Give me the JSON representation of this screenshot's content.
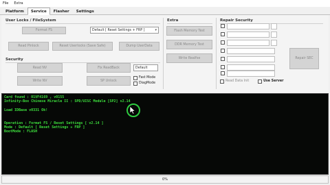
{
  "menu": [
    "File",
    "Extra"
  ],
  "tabs": [
    "Platform",
    "Service",
    "Flasher",
    "Settings"
  ],
  "active_tab": "Service",
  "sections": {
    "user_locks": "User Locks / FileSystem",
    "security": "Security",
    "extra": "Extra",
    "repair_security": "Repair Security"
  },
  "buttons": {
    "format_fs": "Format FS",
    "read_pinlock": "Read Pinlock",
    "reset_userlocks": "Reset Userlocks (Save Safe)",
    "dump_userdata": "Dump UserData",
    "read_nv": "Read NV",
    "fix_readback": "Fix ReadBack",
    "write_nv": "Write NV",
    "sp_unlock": "SP Unlock",
    "flash_memory_test": "Flash Memory Test",
    "ddr_memory_test": "DDR Memory Test",
    "write_readfse": "Write Realfse",
    "repair_sec": "Repair SEC"
  },
  "format_select": "Default [ Reset Settings + FRP ]",
  "security_select": "Default",
  "checkboxes": {
    "fast_mode": "Fast Mode",
    "diag_mode": "DiagMode",
    "read_data_init": "Read Data Init",
    "use_server": "Use Server"
  },
  "colors": {
    "log_bg": "#060806",
    "log_text": "#3de03d",
    "cursor_ring": "#2ecc40"
  },
  "log": [
    "Card found : 01VF4169 , v0155",
    "Infinity-Box Chinese Miracle II : SPD/UISC Module [SP2] v2.14",
    "",
    "Load IDBase v0331 Ok!",
    "",
    "",
    "Operation : Format FS / Reset Settings [ v2.14 ]",
    "Mode : Default [ Reset Settings + FRP ]",
    "BootMode : FLASH"
  ],
  "status": {
    "progress_text": "0%"
  }
}
